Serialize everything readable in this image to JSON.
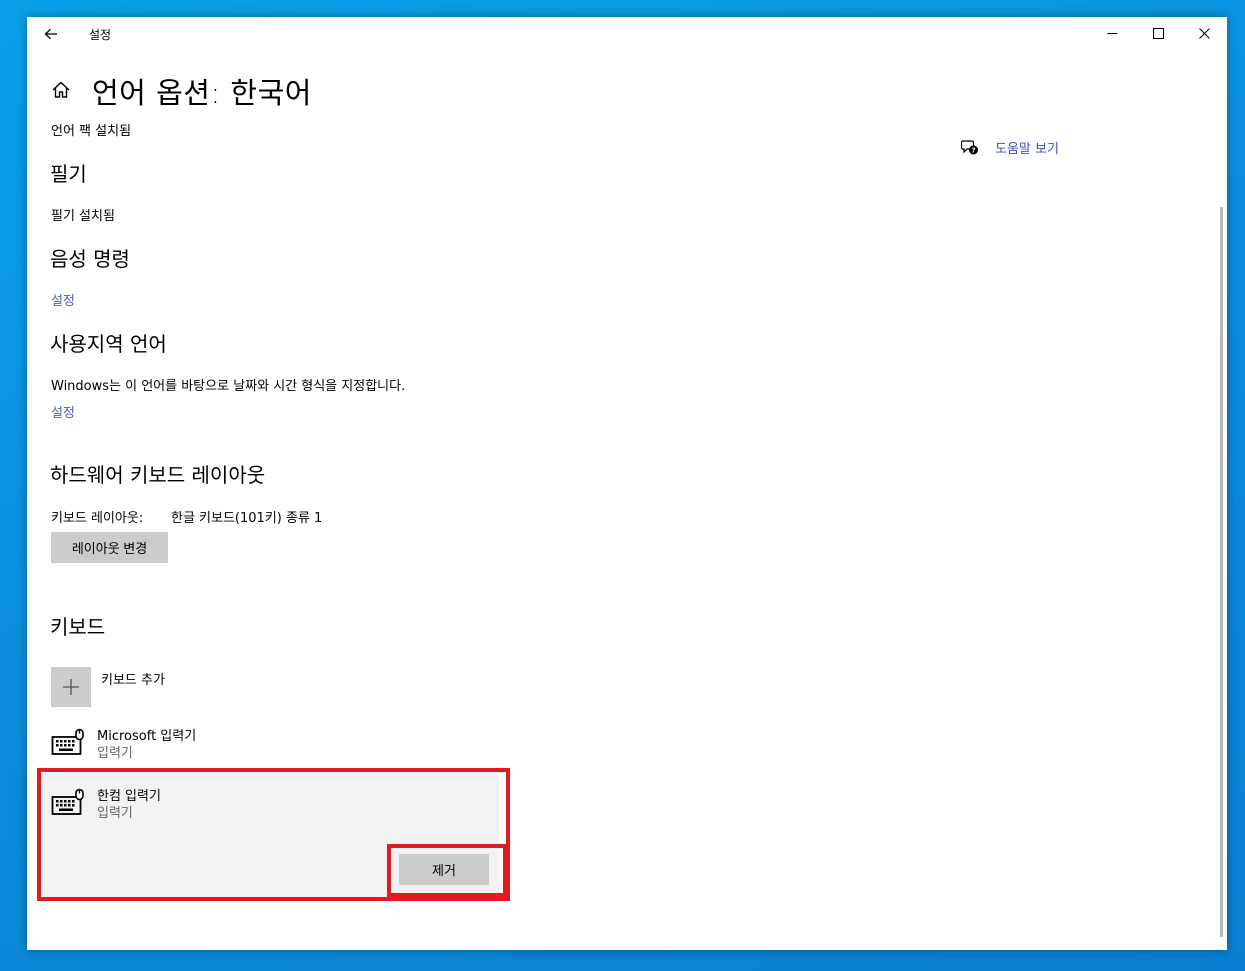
{
  "window": {
    "title": "설정"
  },
  "page": {
    "title": "언어 옵션: 한국어"
  },
  "help": {
    "label": "도움말 보기"
  },
  "language_pack": {
    "status": "언어 팩 설치됨"
  },
  "handwriting": {
    "heading": "필기",
    "status": "필기 설치됨"
  },
  "speech": {
    "heading": "음성 명령",
    "settings_link": "설정"
  },
  "regional": {
    "heading": "사용지역 언어",
    "description": "Windows는 이 언어를 바탕으로 날짜와 시간 형식을 지정합니다.",
    "settings_link": "설정"
  },
  "hardware_keyboard": {
    "heading": "하드웨어 키보드 레이아웃",
    "layout_label": "키보드 레이아웃:",
    "layout_value": "한글 키보드(101키) 종류 1",
    "change_button": "레이아웃 변경"
  },
  "keyboards": {
    "heading": "키보드",
    "add_label": "키보드 추가",
    "items": [
      {
        "name": "Microsoft 입력기",
        "type": "입력기"
      },
      {
        "name": "한컴 입력기",
        "type": "입력기"
      }
    ],
    "remove_button": "제거"
  },
  "colors": {
    "link": "#4a5fc9",
    "highlight": "#e21b23",
    "button": "#cccccc"
  },
  "icons": [
    "back-arrow-icon",
    "minimize-icon",
    "maximize-icon",
    "close-icon",
    "home-icon",
    "help-chat-icon",
    "plus-icon",
    "keyboard-icon"
  ]
}
